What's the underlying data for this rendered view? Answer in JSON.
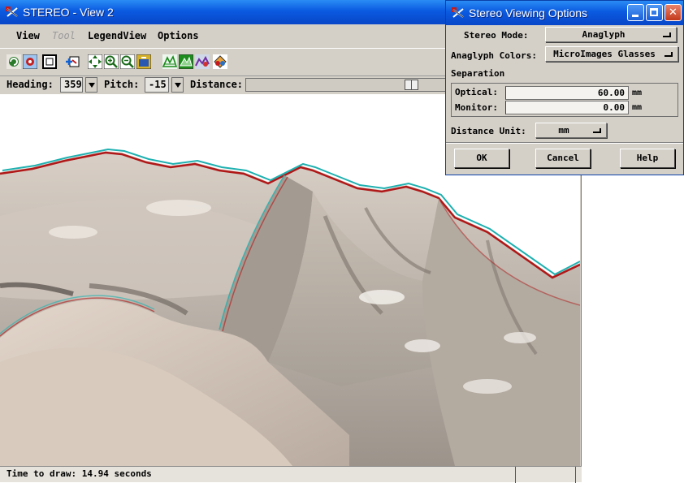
{
  "main_window": {
    "title": "STEREO - View 2",
    "menu": [
      "View",
      "Tool",
      "LegendView",
      "Options"
    ],
    "toolbar_icons": [
      "redraw-icon",
      "full-view-icon",
      "extents-icon",
      "add-layer-icon",
      "pan-icon",
      "zoom-in-icon",
      "zoom-out-icon",
      "capture-icon",
      "surface-icon",
      "terrain-icon",
      "profile-icon",
      "stereo-icon"
    ],
    "nav": {
      "heading_label": "Heading:",
      "heading_value": "359",
      "pitch_label": "Pitch:",
      "pitch_value": "-15",
      "distance_label": "Distance:",
      "distance_fraction": 0.5
    },
    "status": "Time to draw: 14.94 seconds"
  },
  "dialog": {
    "title": "Stereo Viewing Options",
    "stereo_mode_label": "Stereo Mode:",
    "stereo_mode_value": "Anaglyph",
    "anaglyph_colors_label": "Anaglyph Colors:",
    "anaglyph_colors_value": "MicroImages Glasses",
    "separation_label": "Separation",
    "optical_label": "Optical:",
    "optical_value": "60.00",
    "optical_unit": "mm",
    "monitor_label": "Monitor:",
    "monitor_value": "0.00",
    "monitor_unit": "mm",
    "distance_unit_label": "Distance Unit:",
    "distance_unit_value": "mm",
    "buttons": {
      "ok": "OK",
      "cancel": "Cancel",
      "help": "Help"
    }
  },
  "colors": {
    "titlebar": "#0a5ae0",
    "chrome": "#d4d0c8",
    "anaglyph_red": "#b01818",
    "anaglyph_cyan": "#1fb0b0",
    "terrain_light": "#d8cfc6",
    "terrain_dark": "#8a847c"
  }
}
